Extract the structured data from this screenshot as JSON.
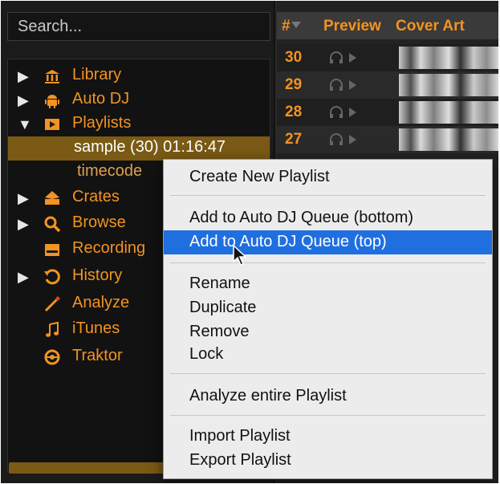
{
  "search": {
    "placeholder": "Search..."
  },
  "sidebar": {
    "items": [
      {
        "label": "Library",
        "icon": "library-icon",
        "arrow": "▶"
      },
      {
        "label": "Auto DJ",
        "icon": "android-icon",
        "arrow": "▶"
      },
      {
        "label": "Playlists",
        "icon": "playlist-icon",
        "arrow": "▼"
      },
      {
        "label": "sample (30) 01:16:47"
      },
      {
        "label": "timecode"
      },
      {
        "label": "Crates",
        "icon": "crate-icon",
        "arrow": "▶"
      },
      {
        "label": "Browse",
        "icon": "search-icon",
        "arrow": "▶"
      },
      {
        "label": "Recording",
        "icon": "recording-icon"
      },
      {
        "label": "History",
        "icon": "history-icon",
        "arrow": "▶"
      },
      {
        "label": "Analyze",
        "icon": "analyze-icon"
      },
      {
        "label": "iTunes",
        "icon": "itunes-icon"
      },
      {
        "label": "Traktor",
        "icon": "traktor-icon"
      }
    ]
  },
  "table": {
    "headers": {
      "num": "#",
      "preview": "Preview",
      "cover": "Cover Art"
    },
    "rows": [
      "30",
      "29",
      "28",
      "27"
    ]
  },
  "context_menu": {
    "create": "Create New Playlist",
    "add_bottom": "Add to Auto DJ Queue (bottom)",
    "add_top": "Add to Auto DJ Queue (top)",
    "rename": "Rename",
    "duplicate": "Duplicate",
    "remove": "Remove",
    "lock": "Lock",
    "analyze": "Analyze entire Playlist",
    "import": "Import Playlist",
    "export": "Export Playlist"
  },
  "colors": {
    "accent": "#f29322",
    "selected": "#7a5a14",
    "menu_highlight": "#1f6fe0"
  }
}
